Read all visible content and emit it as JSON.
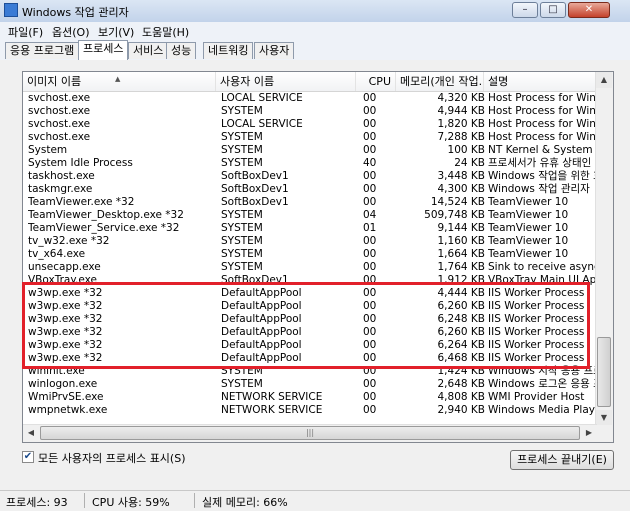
{
  "window": {
    "title": "Windows 작업 관리자",
    "minimize": "–",
    "maximize": "□",
    "close": "✕"
  },
  "menu": [
    "파일(F)",
    "옵션(O)",
    "보기(V)",
    "도움말(H)"
  ],
  "tabs": [
    "응용 프로그램",
    "프로세스",
    "서비스",
    "성능",
    "네트워킹",
    "사용자"
  ],
  "active_tab": "프로세스",
  "columns": {
    "name": "이미지 이름",
    "user": "사용자 이름",
    "cpu": "CPU",
    "mem": "메모리(개인 작업...",
    "desc": "설명"
  },
  "rows": [
    {
      "name": "svchost.exe",
      "user": "LOCAL SERVICE",
      "cpu": "00",
      "mem": "4,320 KB",
      "desc": "Host Process for Windows"
    },
    {
      "name": "svchost.exe",
      "user": "SYSTEM",
      "cpu": "00",
      "mem": "4,944 KB",
      "desc": "Host Process for Windows"
    },
    {
      "name": "svchost.exe",
      "user": "LOCAL SERVICE",
      "cpu": "00",
      "mem": "1,820 KB",
      "desc": "Host Process for Windows"
    },
    {
      "name": "svchost.exe",
      "user": "SYSTEM",
      "cpu": "00",
      "mem": "7,288 KB",
      "desc": "Host Process for Windows"
    },
    {
      "name": "System",
      "user": "SYSTEM",
      "cpu": "00",
      "mem": "100 KB",
      "desc": "NT Kernel & System"
    },
    {
      "name": "System Idle Process",
      "user": "SYSTEM",
      "cpu": "40",
      "mem": "24 KB",
      "desc": "프로세서가 유휴 상태인 시간"
    },
    {
      "name": "taskhost.exe",
      "user": "SoftBoxDev1",
      "cpu": "00",
      "mem": "3,448 KB",
      "desc": "Windows 작업을 위한 호스트"
    },
    {
      "name": "taskmgr.exe",
      "user": "SoftBoxDev1",
      "cpu": "00",
      "mem": "4,300 KB",
      "desc": "Windows 작업 관리자"
    },
    {
      "name": "TeamViewer.exe *32",
      "user": "SoftBoxDev1",
      "cpu": "00",
      "mem": "14,524 KB",
      "desc": "TeamViewer 10"
    },
    {
      "name": "TeamViewer_Desktop.exe *32",
      "user": "SYSTEM",
      "cpu": "04",
      "mem": "509,748 KB",
      "desc": "TeamViewer 10"
    },
    {
      "name": "TeamViewer_Service.exe *32",
      "user": "SYSTEM",
      "cpu": "01",
      "mem": "9,144 KB",
      "desc": "TeamViewer 10"
    },
    {
      "name": "tv_w32.exe *32",
      "user": "SYSTEM",
      "cpu": "00",
      "mem": "1,160 KB",
      "desc": "TeamViewer 10"
    },
    {
      "name": "tv_x64.exe",
      "user": "SYSTEM",
      "cpu": "00",
      "mem": "1,664 KB",
      "desc": "TeamViewer 10"
    },
    {
      "name": "unsecapp.exe",
      "user": "SYSTEM",
      "cpu": "00",
      "mem": "1,764 KB",
      "desc": "Sink to receive asynchronous"
    },
    {
      "name": "VBoxTray.exe",
      "user": "SoftBoxDev1",
      "cpu": "00",
      "mem": "1,912 KB",
      "desc": "VBoxTray Main UI Application"
    },
    {
      "name": "w3wp.exe *32",
      "user": "DefaultAppPool",
      "cpu": "00",
      "mem": "4,444 KB",
      "desc": "IIS Worker Process"
    },
    {
      "name": "w3wp.exe *32",
      "user": "DefaultAppPool",
      "cpu": "00",
      "mem": "6,260 KB",
      "desc": "IIS Worker Process"
    },
    {
      "name": "w3wp.exe *32",
      "user": "DefaultAppPool",
      "cpu": "00",
      "mem": "6,248 KB",
      "desc": "IIS Worker Process"
    },
    {
      "name": "w3wp.exe *32",
      "user": "DefaultAppPool",
      "cpu": "00",
      "mem": "6,260 KB",
      "desc": "IIS Worker Process"
    },
    {
      "name": "w3wp.exe *32",
      "user": "DefaultAppPool",
      "cpu": "00",
      "mem": "6,264 KB",
      "desc": "IIS Worker Process"
    },
    {
      "name": "w3wp.exe *32",
      "user": "DefaultAppPool",
      "cpu": "00",
      "mem": "6,468 KB",
      "desc": "IIS Worker Process"
    },
    {
      "name": "wininit.exe",
      "user": "SYSTEM",
      "cpu": "00",
      "mem": "1,424 KB",
      "desc": "Windows 시작 응용 프로그램"
    },
    {
      "name": "winlogon.exe",
      "user": "SYSTEM",
      "cpu": "00",
      "mem": "2,648 KB",
      "desc": "Windows 로그온 응용 프로그램"
    },
    {
      "name": "WmiPrvSE.exe",
      "user": "NETWORK SERVICE",
      "cpu": "00",
      "mem": "4,808 KB",
      "desc": "WMI Provider Host"
    },
    {
      "name": "wmpnetwk.exe",
      "user": "NETWORK SERVICE",
      "cpu": "00",
      "mem": "2,940 KB",
      "desc": "Windows Media Player Network"
    }
  ],
  "show_all_users": {
    "label": "모든 사용자의 프로세스 표시(S)",
    "checked": "✔"
  },
  "end_process_button": "프로세스 끝내기(E)",
  "status": {
    "processes": "프로세스: 93",
    "cpu": "CPU 사용: 59%",
    "memory": "실제 메모리: 66%"
  },
  "colors": {
    "highlight": "#e2202a",
    "title_bar": "#c2d3ea"
  }
}
